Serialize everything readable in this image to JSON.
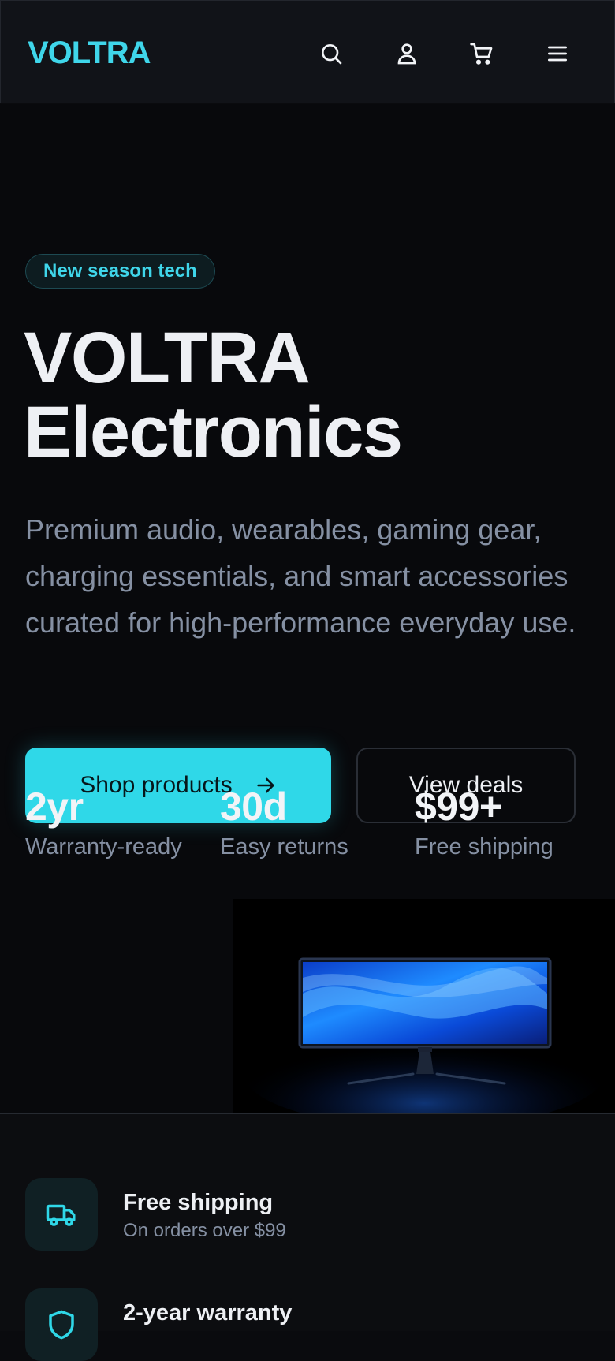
{
  "header": {
    "logo": "VOLTRA",
    "icons": [
      "search-icon",
      "user-icon",
      "cart-icon",
      "menu-icon"
    ]
  },
  "hero": {
    "badge": "New season tech",
    "title_line1": "VOLTRA",
    "title_line2": "Electronics",
    "description": "Premium audio, wearables, gaming gear, charging essentials, and smart accessories curated for high-performance everyday use.",
    "primary_button": "Shop products",
    "secondary_button": "View deals",
    "stats": [
      {
        "value": "2yr",
        "label": "Warranty-ready"
      },
      {
        "value": "30d",
        "label": "Easy returns"
      },
      {
        "value": "$99+",
        "label": "Free shipping"
      }
    ]
  },
  "features": [
    {
      "icon": "truck-icon",
      "title": "Free shipping",
      "subtitle": "On orders over $99"
    },
    {
      "icon": "shield-icon",
      "title": "2-year warranty",
      "subtitle": ""
    }
  ],
  "colors": {
    "accent": "#2fd8e8",
    "background": "#0a0b0e",
    "muted": "#8590a3"
  }
}
